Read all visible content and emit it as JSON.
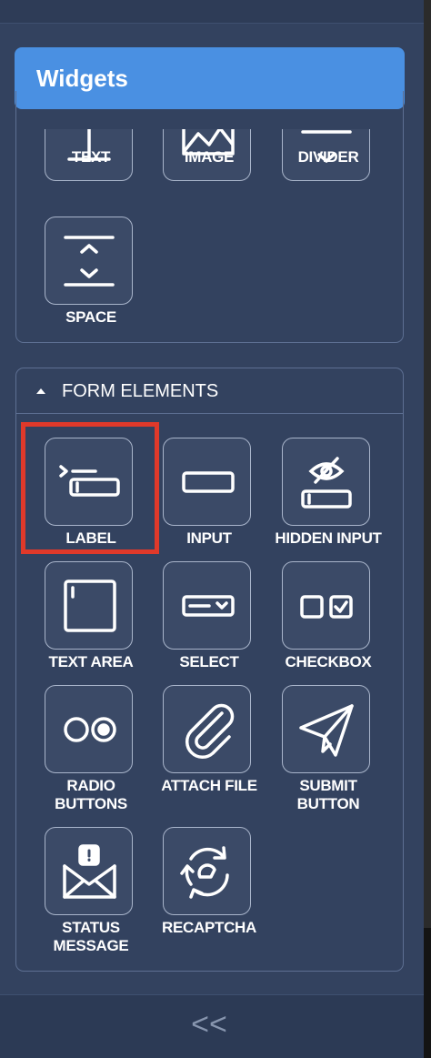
{
  "header": {
    "title": "Widgets"
  },
  "basic": {
    "items": [
      {
        "label": "TEXT",
        "icon": "text-icon"
      },
      {
        "label": "IMAGE",
        "icon": "image-icon"
      },
      {
        "label": "DIVIDER",
        "icon": "divider-icon"
      },
      {
        "label": "SPACE",
        "icon": "space-icon"
      }
    ]
  },
  "form_elements": {
    "title": "FORM ELEMENTS",
    "items": [
      {
        "label": "LABEL",
        "icon": "label-icon",
        "highlighted": true
      },
      {
        "label": "INPUT",
        "icon": "input-icon"
      },
      {
        "label": "HIDDEN INPUT",
        "icon": "hidden-input-icon"
      },
      {
        "label": "TEXT AREA",
        "icon": "text-area-icon"
      },
      {
        "label": "SELECT",
        "icon": "select-icon"
      },
      {
        "label": "CHECKBOX",
        "icon": "checkbox-icon"
      },
      {
        "label_lines": [
          "RADIO",
          "BUTTONS"
        ],
        "icon": "radio-buttons-icon"
      },
      {
        "label": "ATTACH FILE",
        "icon": "paperclip-icon"
      },
      {
        "label_lines": [
          "SUBMIT",
          "BUTTON"
        ],
        "icon": "paper-plane-icon"
      },
      {
        "label_lines": [
          "STATUS",
          "MESSAGE"
        ],
        "icon": "envelope-alert-icon"
      },
      {
        "label": "RECAPTCHA",
        "icon": "recaptcha-icon"
      }
    ]
  },
  "footer": {
    "collapse_label": "<<"
  },
  "colors": {
    "panel": "#33425f",
    "accent": "#4a90e2",
    "highlight": "#e0392a",
    "tile_border": "#a9b5cb"
  }
}
